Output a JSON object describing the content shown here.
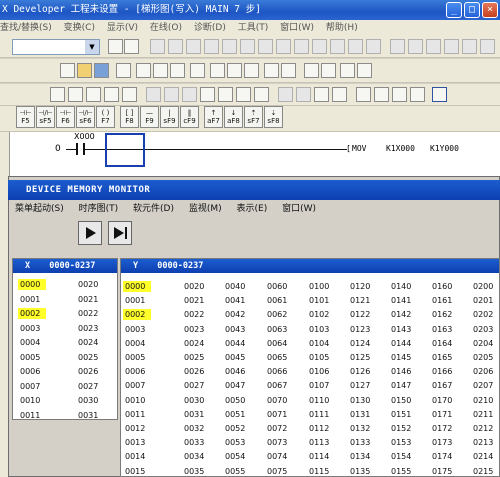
{
  "title": "X Developer 工程未设置 - [梯形图(写入)       MAIN    7 步]",
  "menu": [
    "查找/替换(S)",
    "变换(C)",
    "显示(V)",
    "在线(O)",
    "诊断(D)",
    "工具(T)",
    "窗口(W)",
    "帮助(H)"
  ],
  "fkeys": [
    {
      "sym": "⊣⊢",
      "key": "F5"
    },
    {
      "sym": "⊣/⊢",
      "key": "sF5"
    },
    {
      "sym": "⊣⊢",
      "key": "F6"
    },
    {
      "sym": "⊣/⊢",
      "key": "sF6"
    },
    {
      "sym": "( )",
      "key": "F7"
    },
    {
      "sym": "[ ]",
      "key": "F8"
    },
    {
      "sym": "—",
      "key": "F9"
    },
    {
      "sym": "|",
      "key": "sF9"
    },
    {
      "sym": "‖",
      "key": "cF9"
    },
    {
      "sym": "↑",
      "key": "aF7"
    },
    {
      "sym": "↓",
      "key": "aF8"
    },
    {
      "sym": "⇡",
      "key": "sF7"
    },
    {
      "sym": "⇣",
      "key": "sF8"
    },
    {
      "sym": "↑↓",
      "key": "aF5"
    },
    {
      "sym": "⊣↑",
      "key": "caF5"
    },
    {
      "sym": "⊣↓",
      "key": "caF10"
    },
    {
      "sym": "F10",
      "key": "F10"
    },
    {
      "sym": "~",
      "key": "aF9"
    }
  ],
  "ladder": {
    "step": "0",
    "contact": "X000",
    "instruction": "MOV",
    "src": "K1X000",
    "dst": "K1Y000"
  },
  "monitor": {
    "title": "DEVICE MEMORY MONITOR",
    "menu": [
      "菜单起动(S)",
      "时序图(T)",
      "软元件(D)",
      "监视(M)",
      "表示(E)",
      "窗口(W)"
    ],
    "x_panel": {
      "label": "X",
      "range": "0000-0237",
      "columns": [
        [
          "0000",
          "0001",
          "0002",
          "0003",
          "0004",
          "0005",
          "0006",
          "0007",
          "0010",
          "0011"
        ],
        [
          "0020",
          "0021",
          "0022",
          "0023",
          "0024",
          "0025",
          "0026",
          "0027",
          "0030",
          "0031"
        ]
      ],
      "highlighted": [
        "0000",
        "0002"
      ]
    },
    "y_panel": {
      "label": "Y",
      "range": "0000-0237",
      "columns": [
        [
          "0000",
          "0001",
          "0002",
          "0003",
          "0004",
          "0005",
          "0006",
          "0007",
          "0010",
          "0011",
          "0012",
          "0013",
          "0014",
          "0015"
        ],
        [
          "0020",
          "0021",
          "0022",
          "0023",
          "0024",
          "0025",
          "0026",
          "0027",
          "0030",
          "0031",
          "0032",
          "0033",
          "0034",
          "0035"
        ],
        [
          "0040",
          "0041",
          "0042",
          "0043",
          "0044",
          "0045",
          "0046",
          "0047",
          "0050",
          "0051",
          "0052",
          "0053",
          "0054",
          "0055"
        ],
        [
          "0060",
          "0061",
          "0062",
          "0063",
          "0064",
          "0065",
          "0066",
          "0067",
          "0070",
          "0071",
          "0072",
          "0073",
          "0074",
          "0075"
        ],
        [
          "0100",
          "0101",
          "0102",
          "0103",
          "0104",
          "0105",
          "0106",
          "0107",
          "0110",
          "0111",
          "0112",
          "0113",
          "0114",
          "0115"
        ],
        [
          "0120",
          "0121",
          "0122",
          "0123",
          "0124",
          "0125",
          "0126",
          "0127",
          "0130",
          "0131",
          "0132",
          "0133",
          "0134",
          "0135"
        ],
        [
          "0140",
          "0141",
          "0142",
          "0143",
          "0144",
          "0145",
          "0146",
          "0147",
          "0150",
          "0151",
          "0152",
          "0153",
          "0154",
          "0155"
        ],
        [
          "0160",
          "0161",
          "0162",
          "0163",
          "0164",
          "0165",
          "0166",
          "0167",
          "0170",
          "0171",
          "0172",
          "0173",
          "0174",
          "0175"
        ],
        [
          "0200",
          "0201",
          "0202",
          "0203",
          "0204",
          "0205",
          "0206",
          "0207",
          "0210",
          "0211",
          "0212",
          "0213",
          "0214",
          "0215"
        ]
      ],
      "highlighted": [
        "0000",
        "0002"
      ]
    }
  },
  "colors": {
    "titlebar": "#1d56c4",
    "highlight": "#ffff2a",
    "panel_header": "#0d3fb0"
  }
}
